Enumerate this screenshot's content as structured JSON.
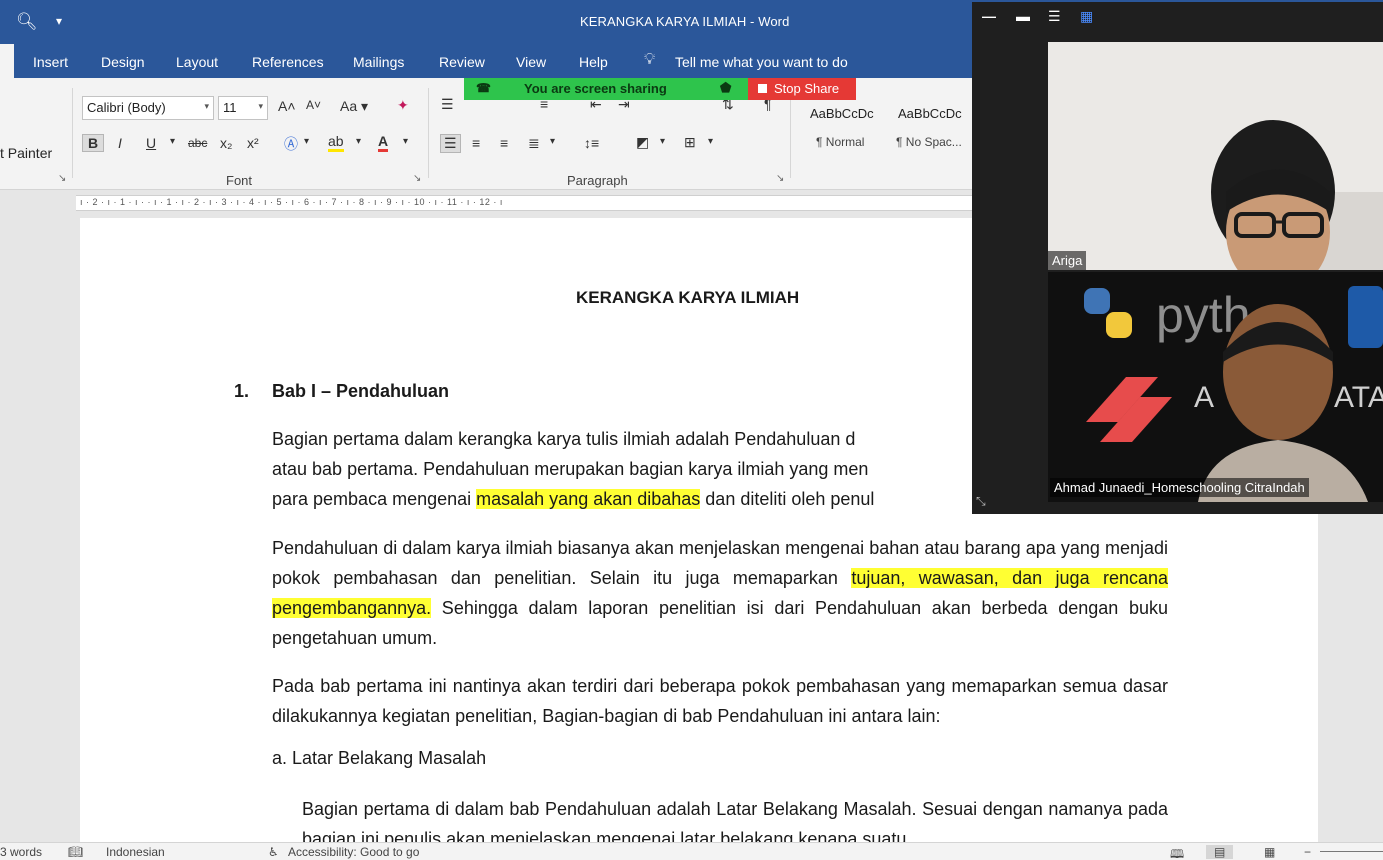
{
  "window": {
    "title": "KERANGKA KARYA ILMIAH  -  Word"
  },
  "tabs": [
    "Insert",
    "Design",
    "Layout",
    "References",
    "Mailings",
    "Review",
    "View",
    "Help"
  ],
  "tell_me": "Tell me what you want to do",
  "ribbon": {
    "clipboard_painter": "t Painter",
    "font": {
      "name": "Calibri (Body)",
      "size": "11",
      "group_label": "Font"
    },
    "paragraph": {
      "group_label": "Paragraph"
    },
    "styles": [
      {
        "sample": "AaBbCcDc",
        "name": "¶ Normal"
      },
      {
        "sample": "AaBbCcDc",
        "name": "¶ No Spac..."
      }
    ]
  },
  "screen_share": {
    "banner": "You are screen sharing",
    "stop": "Stop Share"
  },
  "ruler_marks": "ı · 2 · ı · 1 · ı ·     · ı · 1 · ı · 2 · ı · 3 · ı · 4 · ı · 5 · ı · 6 · ı · 7 · ı · 8 · ı · 9 · ı · 10 · ı · 11 · ı · 12 · ı",
  "document": {
    "title": "KERANGKA KARYA ILMIAH",
    "heading_number": "1.",
    "heading": "Bab I – Pendahuluan",
    "p1": {
      "line1": "Bagian pertama dalam kerangka karya tulis ilmiah adalah Pendahuluan d",
      "line2": "atau bab pertama. Pendahuluan merupakan bagian karya ilmiah yang men",
      "line3_before": "para pembaca mengenai ",
      "line3_highlight": "masalah yang akan dibahas",
      "line3_after": " dan diteliti oleh penul"
    },
    "p2": {
      "before": "Pendahuluan di dalam karya ilmiah biasanya akan menjelaskan mengenai bahan atau barang apa yang menjadi pokok pembahasan dan penelitian. Selain itu juga memaparkan ",
      "highlight": "tujuan, wawasan, dan juga rencana pengembangannya.",
      "after": " Sehingga dalam laporan penelitian isi dari Pendahuluan akan berbeda dengan buku pengetahuan umum."
    },
    "p3": "Pada bab pertama ini nantinya akan terdiri dari beberapa pokok pembahasan yang memaparkan semua dasar dilakukannya kegiatan penelitian, Bagian-bagian di bab Pendahuluan ini antara lain:",
    "sub_heading": "a.  Latar Belakang Masalah",
    "p4": "Bagian pertama di dalam bab Pendahuluan adalah Latar Belakang Masalah. Sesuai dengan namanya pada bagian ini penulis akan menjelaskan mengenai latar belakang kenapa suatu"
  },
  "status": {
    "words": "3 words",
    "language": "Indonesian",
    "accessibility": "Accessibility: Good to go"
  },
  "zoom": {
    "participant1": "Ariga",
    "participant2": "Ahmad Junaedi_Homeschooling CitraIndah",
    "background_text_1": "pyth",
    "background_text_2": "A",
    "background_text_3": "ATA"
  },
  "colors": {
    "word_blue": "#2b579a",
    "share_green": "#2ec44c",
    "stop_red": "#e53935",
    "highlight": "#ffff33"
  }
}
